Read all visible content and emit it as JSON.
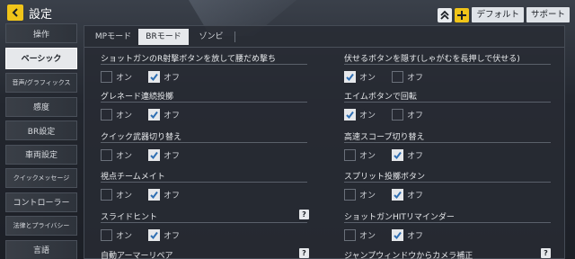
{
  "header": {
    "title": "設定",
    "default_label": "デフォルト",
    "support_label": "サポート",
    "colors": {
      "accent": "#f0c419",
      "panel": "#2b3038"
    }
  },
  "sidebar": {
    "items": [
      {
        "label": "操作"
      },
      {
        "label": "ベーシック"
      },
      {
        "label": "音声/グラフィックス"
      },
      {
        "label": "感度"
      },
      {
        "label": "BR設定"
      },
      {
        "label": "車両設定"
      },
      {
        "label": "クイックメッセージ"
      },
      {
        "label": "コントローラー"
      },
      {
        "label": "法律とプライバシー"
      },
      {
        "label": "言語"
      }
    ],
    "active": "ベーシック"
  },
  "tabs": [
    {
      "label": "MPモード"
    },
    {
      "label": "BRモード"
    },
    {
      "label": "ゾンビ"
    }
  ],
  "active_tab": "BRモード",
  "options": {
    "on": "オン",
    "off": "オフ"
  },
  "settings_left": [
    {
      "label": "ショットガンのR射撃ボタンを放して腰だめ撃ち",
      "value": "off"
    },
    {
      "label": "グレネード連続投擲",
      "value": "off"
    },
    {
      "label": "クイック武器切り替え",
      "value": "off"
    },
    {
      "label": "視点チームメイト",
      "value": "off"
    },
    {
      "label": "スライドヒント",
      "value": "off"
    },
    {
      "label": "自動アーマーリペア",
      "value": "off"
    }
  ],
  "settings_right": [
    {
      "label": "伏せるボタンを隠す(しゃがむを長押しで伏せる)",
      "value": "on"
    },
    {
      "label": "エイムボタンで回転",
      "value": "on"
    },
    {
      "label": "高速スコープ切り替え",
      "value": "off"
    },
    {
      "label": "スプリット投擲ボタン",
      "value": "off"
    },
    {
      "label": "ショットガンHITリマインダー",
      "value": "off"
    },
    {
      "label": "ジャンプウィンドウからカメラ補正",
      "value": "off"
    }
  ],
  "help_glyph": "?"
}
